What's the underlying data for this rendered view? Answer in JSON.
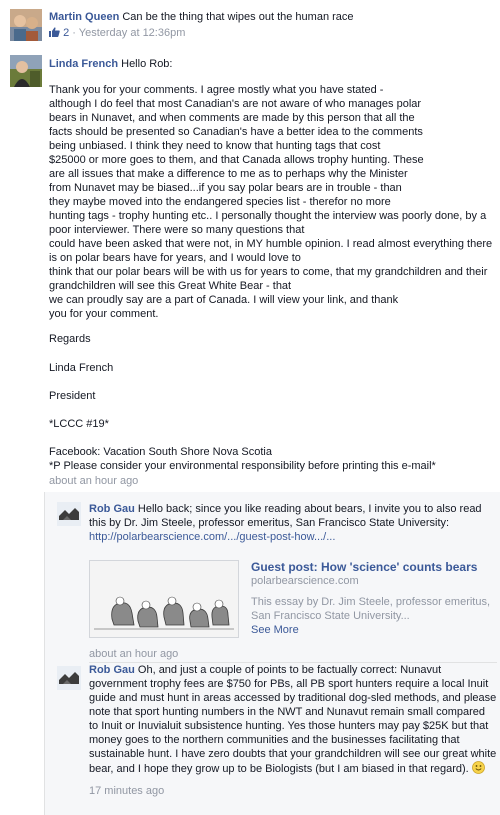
{
  "comments": [
    {
      "author": "Martin Queen",
      "text": "Can be the thing that wipes out the human race",
      "like_count": "2",
      "separator": " · ",
      "time": "Yesterday at 12:36pm"
    },
    {
      "author": "Linda French",
      "greeting": "Hello Rob:",
      "body_lines": [
        "Thank you for your comments. I agree mostly what you have stated -",
        "although I do feel that most Canadian's are not aware of who manages polar",
        "bears in Nunavet, and when comments are made by this person that all the",
        "facts should be presented so Canadian's have a better idea to the comments",
        "being unbiased. I think they need to know that hunting tags that cost",
        "$25000 or more goes to them, and that Canada allows trophy hunting. These",
        "are all issues that make a difference to me as to perhaps why the Minister",
        "from Nunavet may be biased...if you say polar bears are in trouble - than",
        "they maybe moved into the endangered species list - therefor no more",
        "hunting tags - trophy hunting etc.. I personally thought the interview was poorly done, by a",
        "poor interviewer. There were so many questions that",
        "could have been asked that were not, in MY humble opinion. I read almost everything there",
        "is on polar bears have for years, and I would love to",
        "think that our polar bears will be with us for years to come, that my grandchildren and their",
        "grandchildren will see this Great White Bear - that",
        "we can proudly say are a part of Canada. I will view your link, and thank",
        "you for your comment."
      ],
      "regards": "Regards",
      "signature_name": "Linda French",
      "signature_title": "President",
      "signature_tag": "*LCCC #19*",
      "facebook_line": "Facebook: Vacation South Shore Nova Scotia",
      "print_note": "*P Please consider your environmental responsibility before printing this e-mail*",
      "time": "about an hour ago"
    }
  ],
  "replies": [
    {
      "author": "Rob Gau",
      "text": "Hello back; since you like reading about bears, I invite you to also read this by Dr. Jim Steele, professor emeritus, San Francisco State University:",
      "link": "http://polarbearscience.com/.../guest-post-how.../...",
      "preview": {
        "title": "Guest post: How 'science' counts bears",
        "domain": "polarbearscience.com",
        "description": "This essay by Dr. Jim Steele, professor emeritus, San Francisco State University...",
        "see_more": "See More"
      },
      "time": "about an hour ago"
    },
    {
      "author": "Rob Gau",
      "text": "Oh, and just a couple of points to be factually correct: Nunavut government trophy fees are $750 for PBs, all PB sport hunters require a local Inuit guide and must hunt in areas accessed by traditional dog-sled methods, and please note that sport hunting numbers in the NWT and Nunavut remain small compared to Inuit or Inuvialuit subsistence hunting. Yes those hunters may pay $25K but that money goes to the northern communities and the businesses facilitating that sustainable hunt. I have zero doubts that your grandchildren will see our great white bear, and I hope they grow up to be Biologists (but I am biased in that regard).",
      "time": "17 minutes ago"
    }
  ]
}
